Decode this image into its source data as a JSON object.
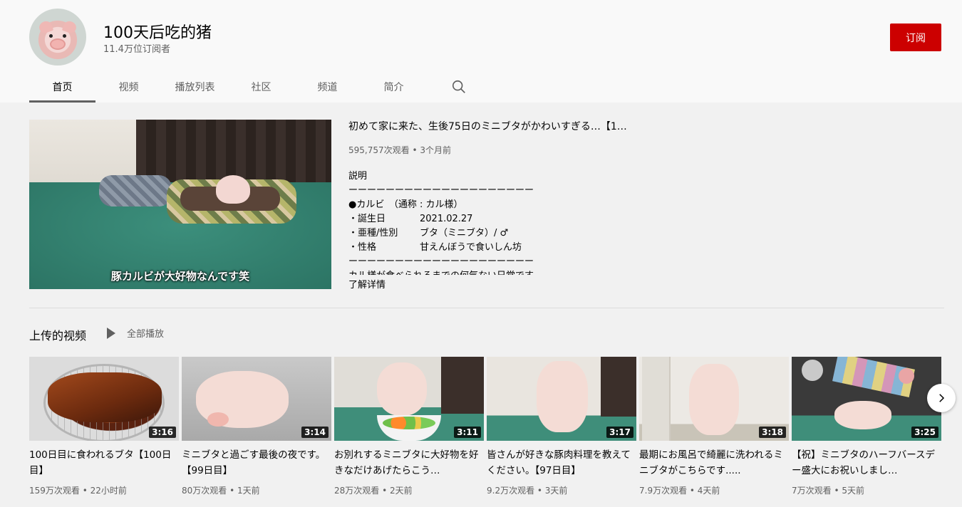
{
  "channel": {
    "title": "100天后吃的猪",
    "subscribers": "11.4万位订阅者",
    "subscribe_label": "订阅"
  },
  "tabs": [
    {
      "label": "首页",
      "active": true
    },
    {
      "label": "视频"
    },
    {
      "label": "播放列表"
    },
    {
      "label": "社区"
    },
    {
      "label": "频道"
    },
    {
      "label": "简介"
    }
  ],
  "search_icon": "search-icon",
  "featured": {
    "title": "初めて家に来た、生後75日のミニブタがかわいすぎる…【1…",
    "meta": "595,757次观看 • 3个月前",
    "thumb_caption": "豚カルビが大好物なんです笑",
    "description": {
      "heading": "説明",
      "rule": "ーーーーーーーーーーーーーーーーーーーー",
      "name_line": "●カルビ　（通称 : カル様）",
      "rows": [
        {
          "k": "・誕生日",
          "v": "2021.02.27"
        },
        {
          "k": "・亜種/性別",
          "v": "ブタ（ミニブタ）/ ♂"
        },
        {
          "k": "・性格",
          "v": "甘えんぼうで食いしん坊"
        }
      ],
      "rule2": "ーーーーーーーーーーーーーーーーーーーー",
      "last_line": "カル様が食べられるまでの何気ない日常です"
    },
    "more_label": "了解详情"
  },
  "uploads": {
    "title": "上传的视频",
    "play_all": "全部播放",
    "videos": [
      {
        "title": "100日目に食われるブタ【100日目】",
        "duration": "3:16",
        "meta": "159万次观看 • 22小时前"
      },
      {
        "title": "ミニブタと過ごす最後の夜です。【99日目】",
        "duration": "3:14",
        "meta": "80万次观看 • 1天前"
      },
      {
        "title": "お別れするミニブタに大好物を好きなだけあげたらこう…",
        "duration": "3:11",
        "meta": "28万次观看 • 2天前"
      },
      {
        "title": "皆さんが好きな豚肉料理を教えてください。【97日目】",
        "duration": "3:17",
        "meta": "9.2万次观看 • 3天前"
      },
      {
        "title": "最期にお風呂で綺麗に洗われるミニブタがこちらです.....",
        "duration": "3:18",
        "meta": "7.9万次观看 • 4天前"
      },
      {
        "title": "【祝】ミニブタのハーフバースデー盛大にお祝いしまし…",
        "duration": "3:25",
        "meta": "7万次观看 • 5天前"
      }
    ]
  },
  "next_icon": "chevron-right-icon",
  "colors": {
    "subscribe": "#cc0000",
    "background": "#f9f9f9",
    "content_bg": "#f1f1f1"
  }
}
